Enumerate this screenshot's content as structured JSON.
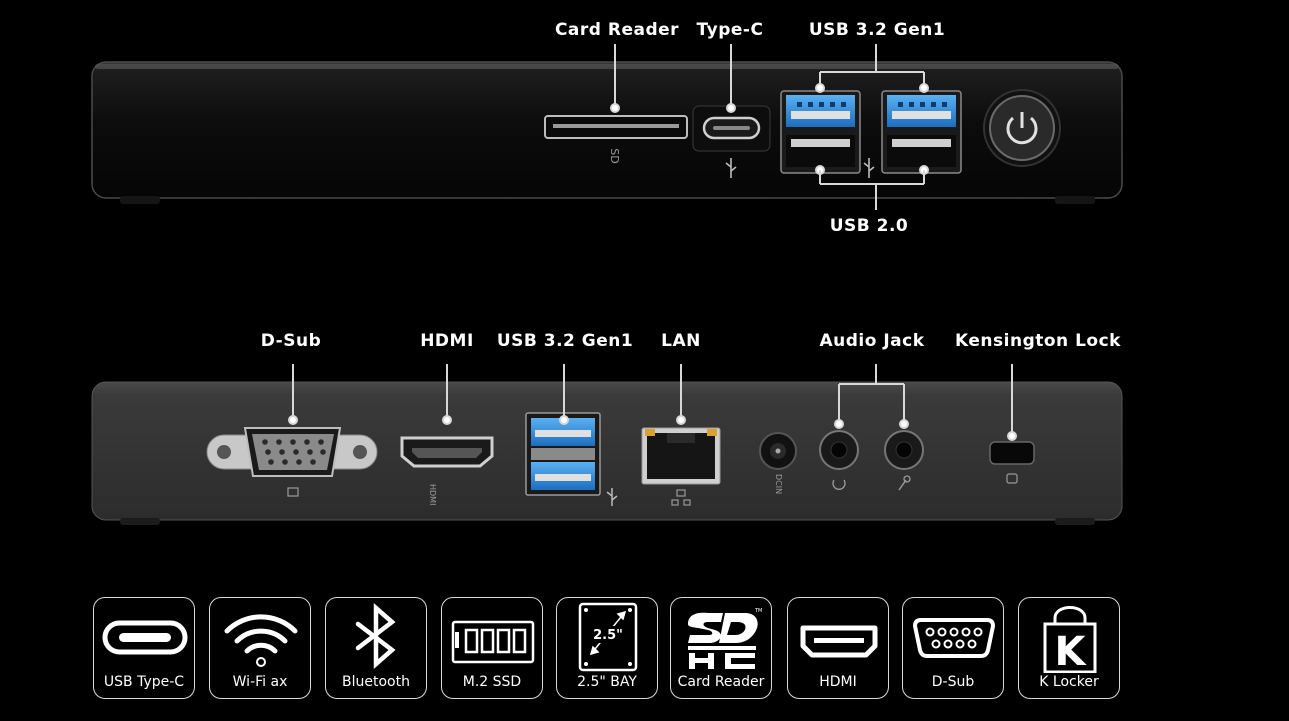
{
  "front_labels": {
    "card_reader": "Card Reader",
    "type_c": "Type-C",
    "usb32_gen1": "USB 3.2 Gen1",
    "usb20": "USB 2.0"
  },
  "rear_labels": {
    "dsub": "D-Sub",
    "hdmi": "HDMI",
    "usb32_gen1": "USB 3.2 Gen1",
    "lan": "LAN",
    "audio_jack": "Audio Jack",
    "kensington_lock": "Kensington Lock"
  },
  "port_markings": {
    "hdmi": "HDMI",
    "dcin": "DCIN"
  },
  "features": [
    {
      "label": "USB Type-C",
      "icon": "usb-type-c-icon"
    },
    {
      "label": "Wi-Fi ax",
      "icon": "wifi-icon"
    },
    {
      "label": "Bluetooth",
      "icon": "bluetooth-icon"
    },
    {
      "label": "M.2 SSD",
      "icon": "m2-ssd-icon"
    },
    {
      "label": "2.5\" BAY",
      "icon": "drive-bay-icon",
      "icon_text": "2.5\""
    },
    {
      "label": "Card Reader",
      "icon": "sdhc-icon"
    },
    {
      "label": "HDMI",
      "icon": "hdmi-icon"
    },
    {
      "label": "D-Sub",
      "icon": "dsub-icon"
    },
    {
      "label": "K Locker",
      "icon": "k-locker-icon",
      "icon_text": "K"
    }
  ],
  "colors": {
    "background": "#000000",
    "usb3_blue": "#2a8fe0",
    "chassis": "#1a1a1a",
    "rear_panel": "#3a3a3a"
  }
}
